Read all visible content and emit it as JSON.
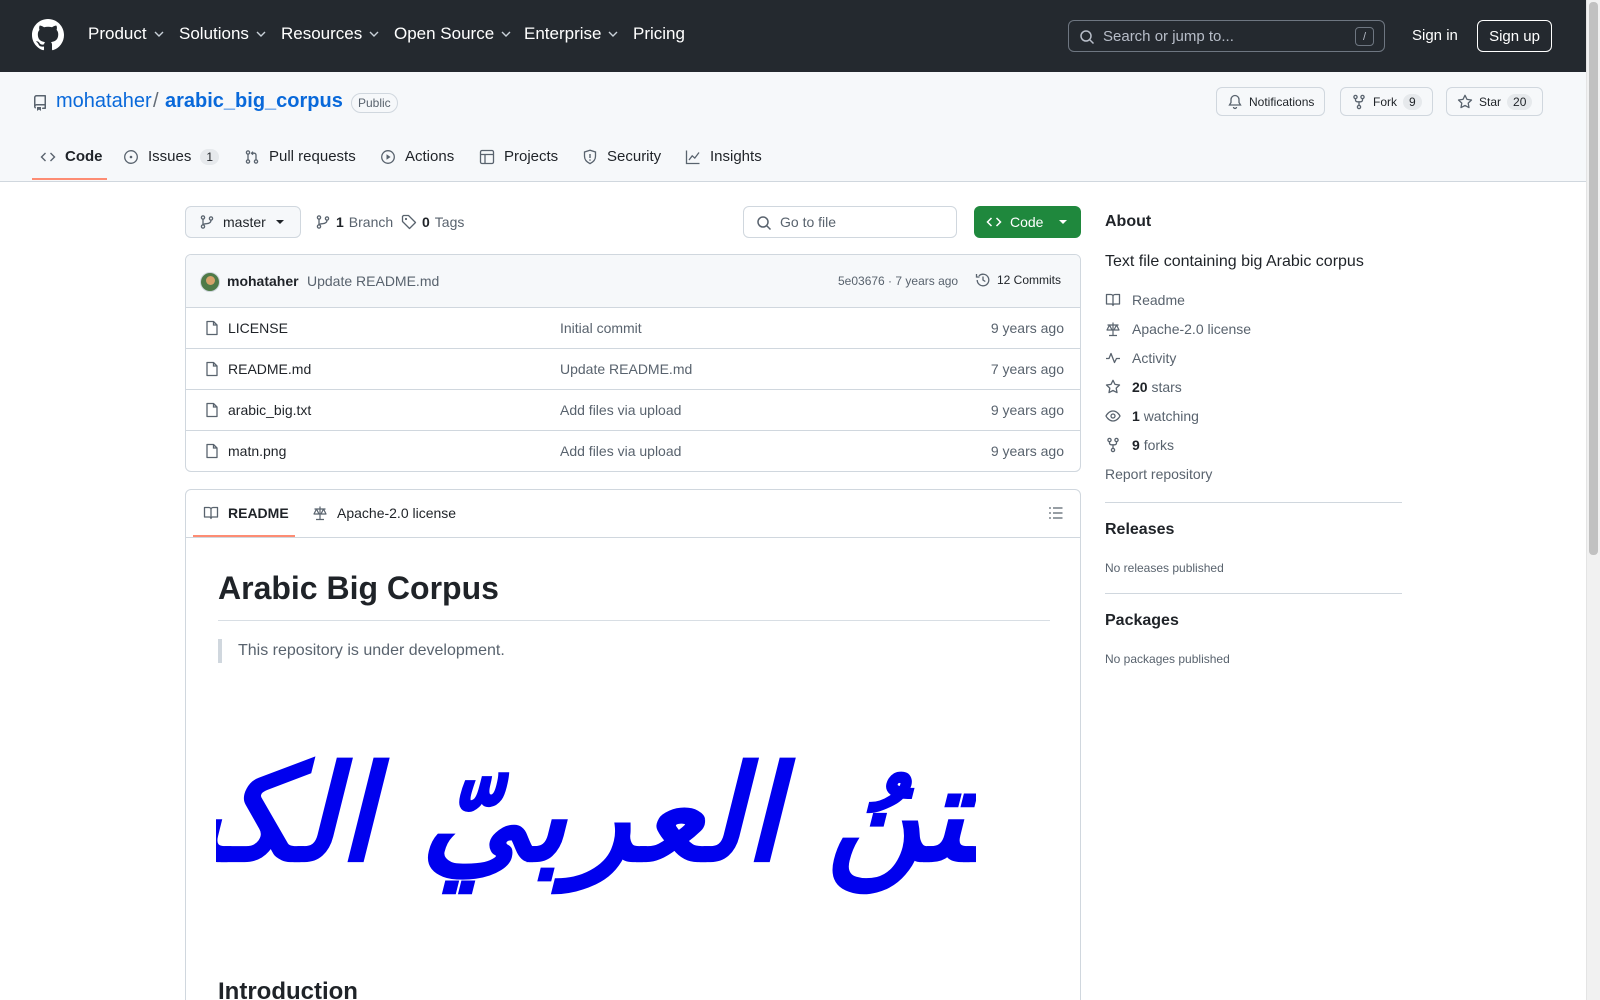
{
  "header": {
    "nav": [
      {
        "label": "Product",
        "dropdown": true
      },
      {
        "label": "Solutions",
        "dropdown": true
      },
      {
        "label": "Resources",
        "dropdown": true
      },
      {
        "label": "Open Source",
        "dropdown": true
      },
      {
        "label": "Enterprise",
        "dropdown": true
      },
      {
        "label": "Pricing",
        "dropdown": false
      }
    ],
    "search_placeholder": "Search or jump to...",
    "search_shortcut": "/",
    "sign_in": "Sign in",
    "sign_up": "Sign up"
  },
  "repo": {
    "owner": "mohataher",
    "separator": "/",
    "name": "arabic_big_corpus",
    "visibility": "Public",
    "notifications_label": "Notifications",
    "fork_label": "Fork",
    "fork_count": "9",
    "star_label": "Star",
    "star_count": "20"
  },
  "tabs": [
    {
      "label": "Code",
      "active": true,
      "icon": "code-icon"
    },
    {
      "label": "Issues",
      "count": "1",
      "icon": "issue-icon"
    },
    {
      "label": "Pull requests",
      "icon": "pull-request-icon"
    },
    {
      "label": "Actions",
      "icon": "play-icon"
    },
    {
      "label": "Projects",
      "icon": "table-icon"
    },
    {
      "label": "Security",
      "icon": "shield-icon"
    },
    {
      "label": "Insights",
      "icon": "graph-icon"
    }
  ],
  "toolbar": {
    "branch": "master",
    "branch_count": "1",
    "branch_label": "Branch",
    "tag_count": "0",
    "tag_label": "Tags",
    "goto_file": "Go to file",
    "code_button": "Code"
  },
  "latest_commit": {
    "author": "mohataher",
    "message": "Update README.md",
    "meta": "5e03676 · 7 years ago",
    "commits": "12 Commits"
  },
  "files": [
    {
      "name": "LICENSE",
      "message": "Initial commit",
      "age": "9 years ago"
    },
    {
      "name": "README.md",
      "message": "Update README.md",
      "age": "7 years ago"
    },
    {
      "name": "arabic_big.txt",
      "message": "Add files via upload",
      "age": "9 years ago"
    },
    {
      "name": "matn.png",
      "message": "Add files via upload",
      "age": "9 years ago"
    }
  ],
  "readme": {
    "tab_readme": "README",
    "tab_license": "Apache-2.0 license",
    "title": "Arabic Big Corpus",
    "quote": "This repository is under development.",
    "image_text": "المتنُ العربيّ الكبير",
    "image_color": "#0000ee",
    "section_heading": "Introduction"
  },
  "sidebar": {
    "about_heading": "About",
    "description": "Text file containing big Arabic corpus",
    "links": [
      {
        "icon": "book-icon",
        "bold": "",
        "text": "Readme"
      },
      {
        "icon": "law-icon",
        "bold": "",
        "text": "Apache-2.0 license"
      },
      {
        "icon": "pulse-icon",
        "bold": "",
        "text": "Activity"
      },
      {
        "icon": "star-icon",
        "bold": "20",
        "text": "stars"
      },
      {
        "icon": "eye-icon",
        "bold": "1",
        "text": "watching"
      },
      {
        "icon": "fork-icon",
        "bold": "9",
        "text": "forks"
      }
    ],
    "report": "Report repository",
    "releases_heading": "Releases",
    "releases_empty": "No releases published",
    "packages_heading": "Packages",
    "packages_empty": "No packages published"
  },
  "colors": {
    "header_bg": "#24292f",
    "link": "#0969da",
    "primary_button": "#1f883d",
    "active_tab_underline": "#fd8c73"
  }
}
